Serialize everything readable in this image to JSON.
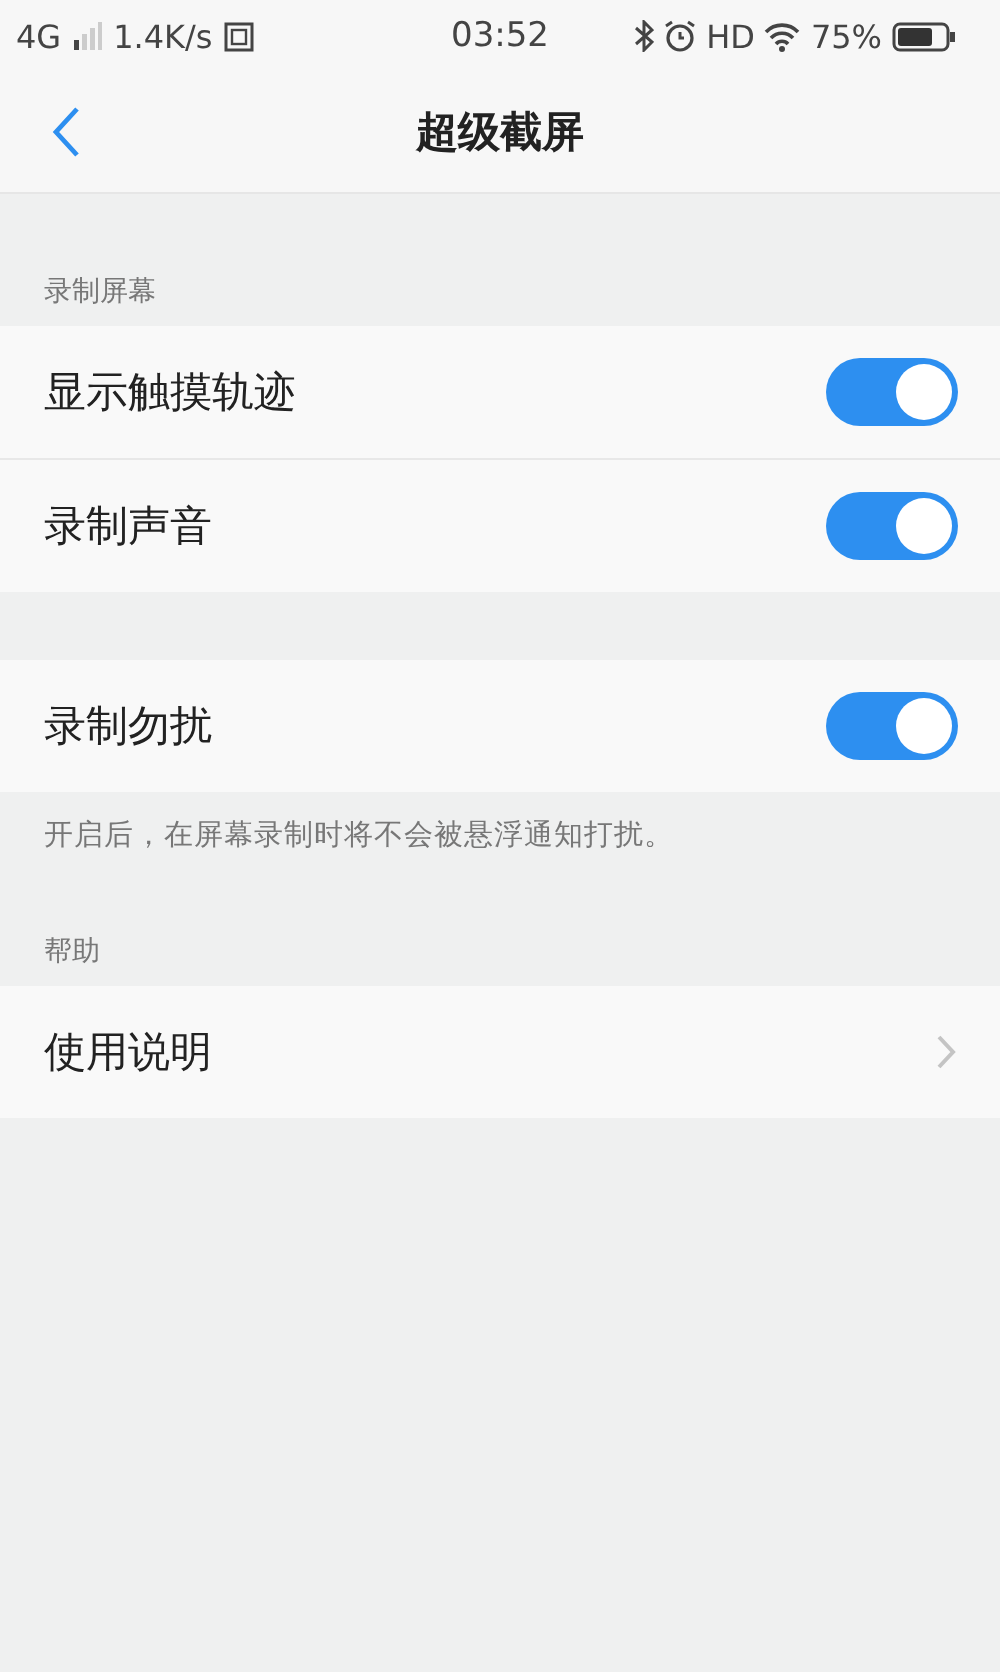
{
  "status_bar": {
    "network": "4G",
    "speed": "1.4K/s",
    "time": "03:52",
    "hd": "HD",
    "battery": "75%"
  },
  "header": {
    "title": "超级截屏"
  },
  "sections": [
    {
      "title": "录制屏幕",
      "rows": [
        {
          "kind": "toggle",
          "label": "显示触摸轨迹",
          "on": true
        },
        {
          "kind": "toggle",
          "label": "录制声音",
          "on": true
        }
      ]
    },
    {
      "rows": [
        {
          "kind": "toggle",
          "label": "录制勿扰",
          "on": true
        }
      ],
      "note": "开启后，在屏幕录制时将不会被悬浮通知打扰。"
    },
    {
      "title": "帮助",
      "rows": [
        {
          "kind": "link",
          "label": "使用说明"
        }
      ]
    }
  ]
}
